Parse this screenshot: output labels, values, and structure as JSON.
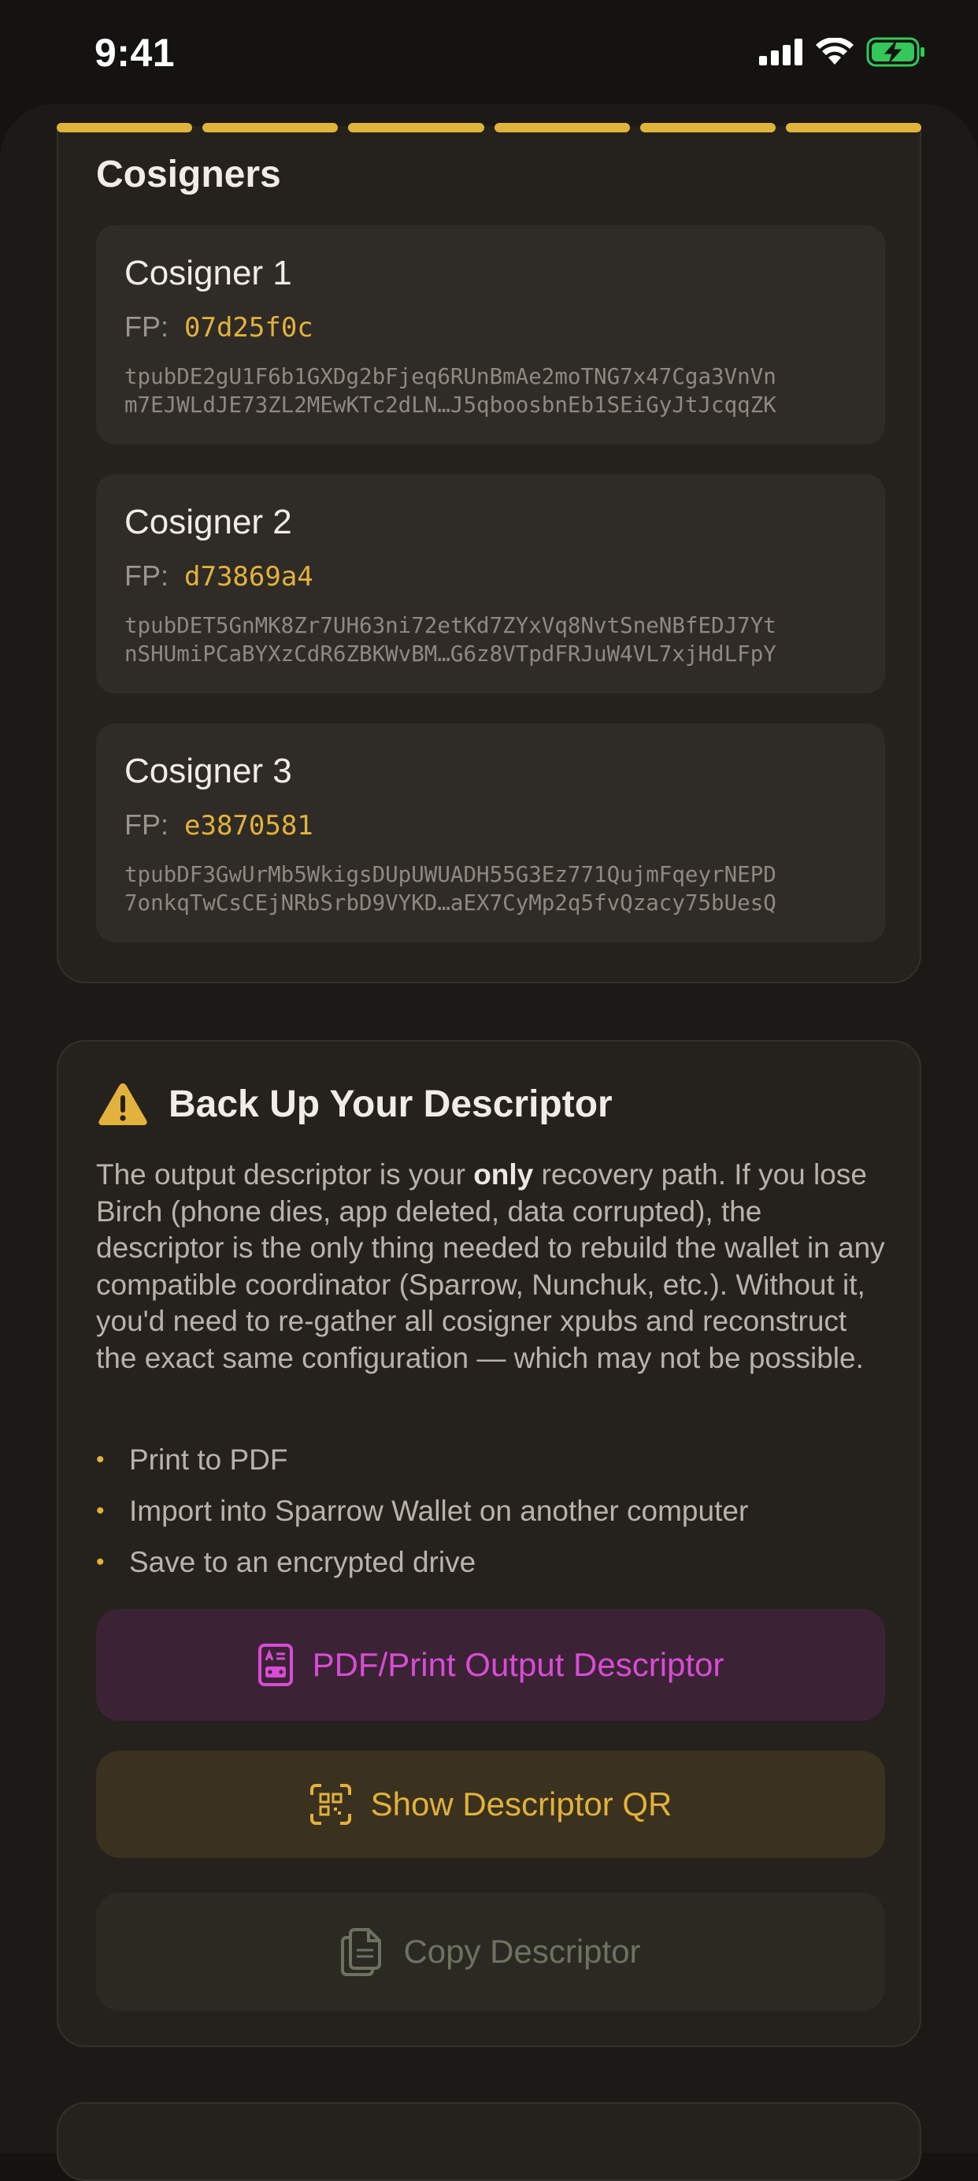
{
  "status_bar": {
    "time": "9:41"
  },
  "progress": {
    "segments": 6,
    "completed": 6,
    "color": "#e0b43a"
  },
  "cosigners_section": {
    "title": "Cosigners",
    "fp_label": "FP:",
    "items": [
      {
        "name": "Cosigner 1",
        "fingerprint": "07d25f0c",
        "xpub_line1": "tpubDE2gU1F6b1GXDg2bFjeq6RUnBmAe2moTNG7x47Cga3VnVn",
        "xpub_line2": "m7EJWLdJE73ZL2MEwKTc2dLN…J5qboosbnEb1SEiGyJtJcqqZK"
      },
      {
        "name": "Cosigner 2",
        "fingerprint": "d73869a4",
        "xpub_line1": "tpubDET5GnMK8Zr7UH63ni72etKd7ZYxVq8NvtSneNBfEDJ7Yt",
        "xpub_line2": "nSHUmiPCaBYXzCdR6ZBKWvBM…G6z8VTpdFRJuW4VL7xjHdLFpY"
      },
      {
        "name": "Cosigner 3",
        "fingerprint": "e3870581",
        "xpub_line1": "tpubDF3GwUrMb5WkigsDUpUWUADH55G3Ez771QujmFqeyrNEPD",
        "xpub_line2": "7onkqTwCsCEjNRbSrbD9VYKD…aEX7CyMp2q5fvQzacy75bUesQ"
      }
    ]
  },
  "backup_section": {
    "title": "Back Up Your Descriptor",
    "warning_icon": "warning-triangle-icon",
    "body_before": "The output descriptor is your ",
    "body_bold": "only",
    "body_after": " recovery path. If you lose Birch (phone dies, app deleted, data corrupted), the descriptor is the only thing needed to rebuild the wallet in any compatible coordinator (Sparrow, Nunchuk, etc.). Without it, you'd need to re-gather all cosigner xpubs and reconstruct the exact same configuration — which may not be possible.",
    "bullets": [
      "Print to PDF",
      "Import into Sparrow Wallet on another computer",
      "Save to an encrypted drive"
    ],
    "buttons": {
      "pdf": {
        "label": "PDF/Print Output Descriptor",
        "icon": "document-print-icon",
        "color": "#d94bd6"
      },
      "qr": {
        "label": "Show Descriptor QR",
        "icon": "qr-scan-icon",
        "color": "#e2b13c"
      },
      "copy": {
        "label": "Copy Descriptor",
        "icon": "copy-documents-icon",
        "color": "#6f7160"
      }
    }
  }
}
